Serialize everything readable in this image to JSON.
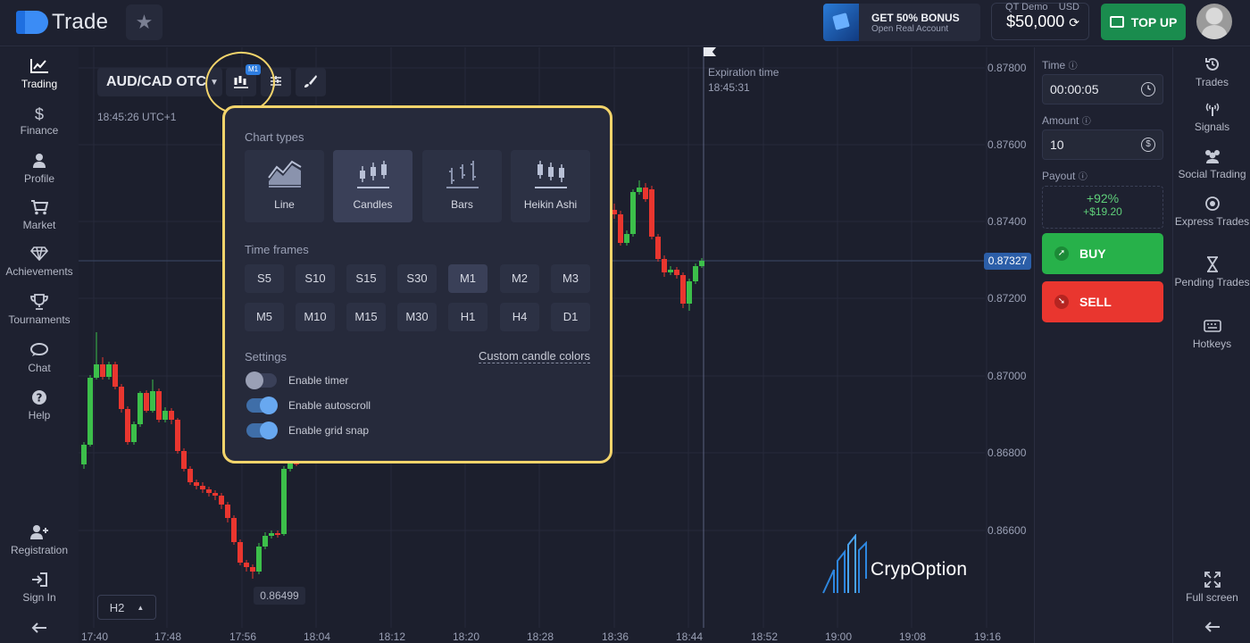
{
  "app": {
    "logo_text": "Trade"
  },
  "header": {
    "bonus_title": "GET 50% BONUS",
    "bonus_sub": "Open Real Account",
    "account_type": "QT Demo",
    "currency": "USD",
    "balance": "$50,000",
    "topup_label": "TOP UP"
  },
  "sidebar": {
    "items": [
      {
        "label": "Trading",
        "icon": "chart-line-icon"
      },
      {
        "label": "Finance",
        "icon": "dollar-icon"
      },
      {
        "label": "Profile",
        "icon": "user-icon"
      },
      {
        "label": "Market",
        "icon": "cart-icon"
      },
      {
        "label": "Achievements",
        "icon": "diamond-icon"
      },
      {
        "label": "Tournaments",
        "icon": "trophy-icon"
      },
      {
        "label": "Chat",
        "icon": "chat-icon"
      },
      {
        "label": "Help",
        "icon": "help-icon"
      }
    ],
    "bottom": [
      {
        "label": "Registration",
        "icon": "user-plus-icon"
      },
      {
        "label": "Sign In",
        "icon": "sign-in-icon"
      }
    ]
  },
  "right_nav": {
    "items": [
      {
        "label": "Trades",
        "icon": "history-icon"
      },
      {
        "label": "Signals",
        "icon": "signal-icon"
      },
      {
        "label": "Social Trading",
        "icon": "users-icon"
      },
      {
        "label": "Express Trades",
        "icon": "target-icon"
      },
      {
        "label": "Pending Trades",
        "icon": "hourglass-icon"
      },
      {
        "label": "Hotkeys",
        "icon": "keyboard-icon"
      }
    ],
    "fullscreen_label": "Full screen"
  },
  "trade_panel": {
    "time_label": "Time",
    "time_value": "00:00:05",
    "amount_label": "Amount",
    "amount_value": "10",
    "payout_label": "Payout",
    "payout_pct": "+92%",
    "payout_amount": "+$19.20",
    "buy_label": "BUY",
    "sell_label": "SELL"
  },
  "chart_toolbar": {
    "asset": "AUD/CAD OTC",
    "timeframe_badge": "M1",
    "server_time": "18:45:26 UTC+1",
    "bottom_timeframe": "H2"
  },
  "expiration": {
    "label": "Expiration time",
    "time": "18:45:31"
  },
  "chart_data": {
    "type": "candlestick",
    "price_axis": [
      "0.87800",
      "0.87600",
      "0.87400",
      "0.87200",
      "0.87000",
      "0.86800",
      "0.86600"
    ],
    "time_axis": [
      "17:40",
      "17:48",
      "17:56",
      "18:04",
      "18:12",
      "18:20",
      "18:28",
      "18:36",
      "18:44",
      "18:52",
      "19:00",
      "19:08",
      "19:16"
    ],
    "current_price": "0.87327",
    "low_marker": "0.86499",
    "up_color": "#3cbf4a",
    "down_color": "#e9362f"
  },
  "popup": {
    "chart_types_title": "Chart types",
    "chart_types": [
      {
        "label": "Line",
        "selected": false
      },
      {
        "label": "Candles",
        "selected": true
      },
      {
        "label": "Bars",
        "selected": false
      },
      {
        "label": "Heikin Ashi",
        "selected": false
      }
    ],
    "time_frames_title": "Time frames",
    "time_frames": [
      [
        "S5",
        "S10",
        "S15",
        "S30",
        "M1",
        "M2",
        "M3"
      ],
      [
        "M5",
        "M10",
        "M15",
        "M30",
        "H1",
        "H4",
        "D1"
      ]
    ],
    "selected_timeframe": "M1",
    "settings_title": "Settings",
    "custom_colors_link": "Custom candle colors",
    "toggles": [
      {
        "label": "Enable timer",
        "on": false
      },
      {
        "label": "Enable autoscroll",
        "on": true
      },
      {
        "label": "Enable grid snap",
        "on": true
      }
    ]
  },
  "watermark": {
    "text": "CrypOption"
  },
  "colors": {
    "accent": "#2e7de0",
    "highlight": "#f3d46b",
    "buy": "#27b14a",
    "sell": "#e9362f"
  }
}
